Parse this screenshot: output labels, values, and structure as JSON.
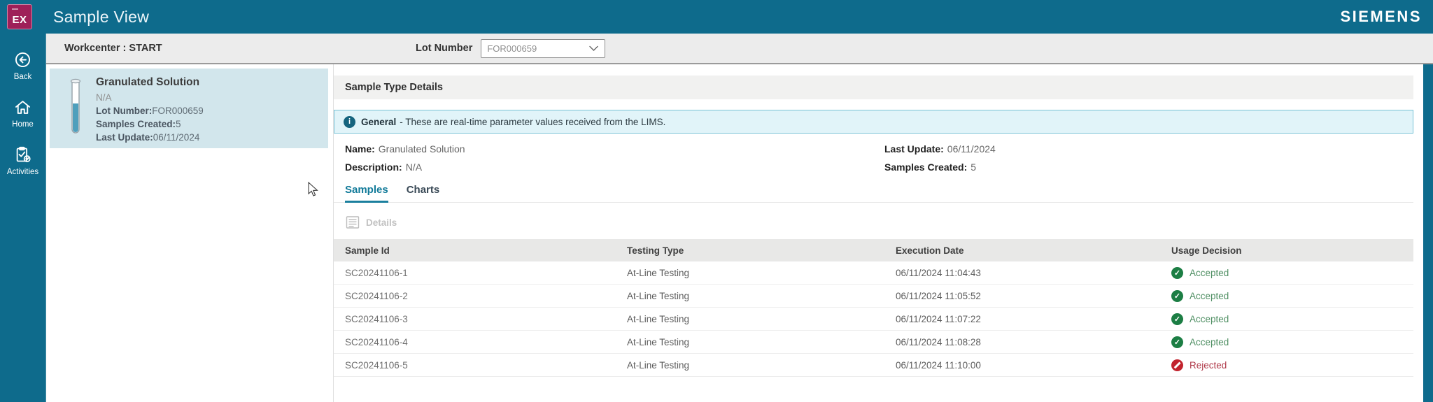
{
  "colors": {
    "accent": "#0e6b8c",
    "logo-bg": "#9e2059",
    "accepted": "#1c7e44",
    "accepted-text": "#4f8f63",
    "rejected": "#c2242e",
    "rejected-text": "#b03a4a",
    "banner-bg": "#e1f4f9",
    "banner-border": "#79c3d6",
    "card-bg": "#d2e6ec"
  },
  "header": {
    "app_badge": "EX",
    "title": "Sample View",
    "brand": "SIEMENS"
  },
  "sidebar": {
    "items": [
      {
        "label": "Back"
      },
      {
        "label": "Home"
      },
      {
        "label": "Activities"
      }
    ]
  },
  "workcenter_bar": {
    "workcenter_text": "Workcenter : START",
    "lot_number_label": "Lot Number",
    "lot_number_value": "FOR000659"
  },
  "sample_card": {
    "title": "Granulated Solution",
    "subtitle": "N/A",
    "lot_number_label": "Lot Number:",
    "lot_number_value": "FOR000659",
    "samples_created_label": "Samples Created:",
    "samples_created_value": "5",
    "last_update_label": "Last Update:",
    "last_update_value": "06/11/2024"
  },
  "main": {
    "section_title": "Sample Type Details",
    "banner": {
      "title": "General",
      "text": "- These are real-time parameter values received from the LIMS."
    },
    "fields": {
      "name_label": "Name:",
      "name_value": "Granulated Solution",
      "description_label": "Description:",
      "description_value": "N/A",
      "last_update_label": "Last Update:",
      "last_update_value": "06/11/2024",
      "samples_created_label": "Samples Created:",
      "samples_created_value": "5"
    },
    "tabs": [
      {
        "label": "Samples",
        "active": true
      },
      {
        "label": "Charts",
        "active": false
      }
    ],
    "toolbar": {
      "details_label": "Details"
    },
    "table": {
      "columns": [
        "Sample Id",
        "Testing Type",
        "Execution Date",
        "Usage Decision"
      ],
      "rows": [
        {
          "sample_id": "SC20241106-1",
          "testing_type": "At-Line Testing",
          "execution_date": "06/11/2024 11:04:43",
          "usage_decision": "Accepted",
          "status": "accepted"
        },
        {
          "sample_id": "SC20241106-2",
          "testing_type": "At-Line Testing",
          "execution_date": "06/11/2024 11:05:52",
          "usage_decision": "Accepted",
          "status": "accepted"
        },
        {
          "sample_id": "SC20241106-3",
          "testing_type": "At-Line Testing",
          "execution_date": "06/11/2024 11:07:22",
          "usage_decision": "Accepted",
          "status": "accepted"
        },
        {
          "sample_id": "SC20241106-4",
          "testing_type": "At-Line Testing",
          "execution_date": "06/11/2024 11:08:28",
          "usage_decision": "Accepted",
          "status": "accepted"
        },
        {
          "sample_id": "SC20241106-5",
          "testing_type": "At-Line Testing",
          "execution_date": "06/11/2024 11:10:00",
          "usage_decision": "Rejected",
          "status": "rejected"
        }
      ]
    }
  }
}
